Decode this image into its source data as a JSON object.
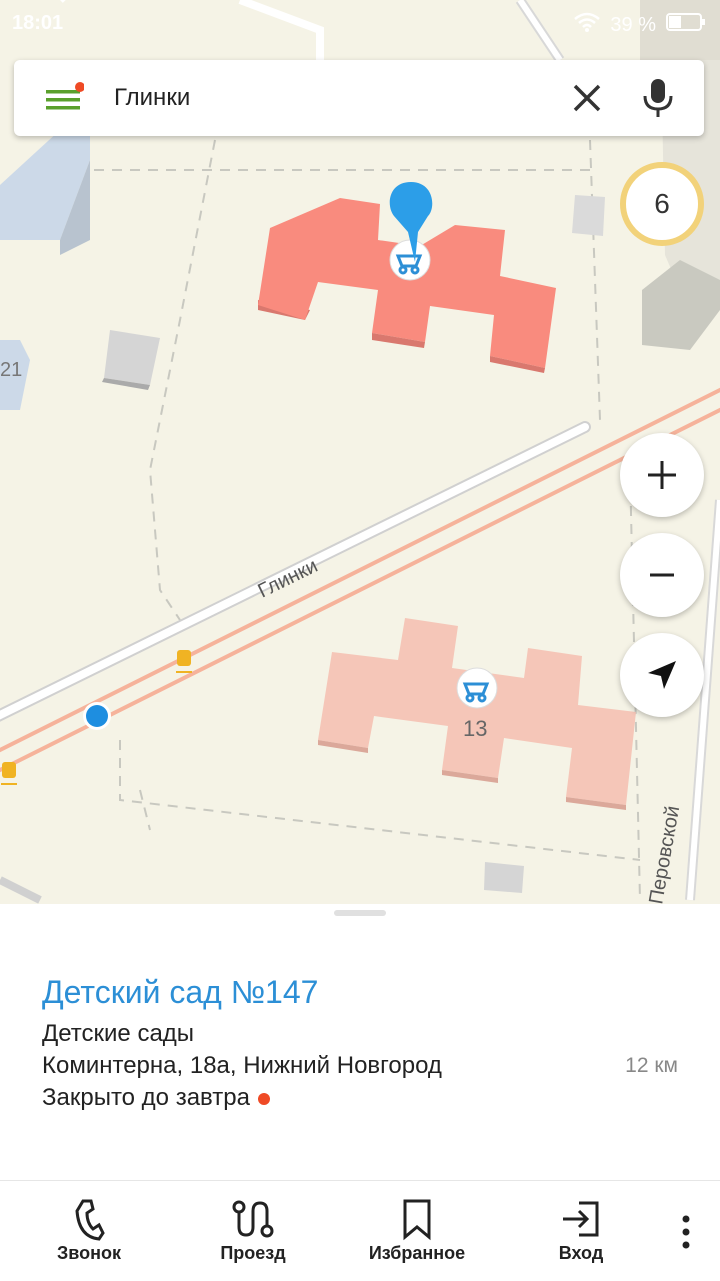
{
  "status_bar": {
    "time": "18:01",
    "battery": "39 %"
  },
  "search": {
    "query": "Глинки"
  },
  "map": {
    "cluster_count": "6",
    "street_glinki": "Глинки",
    "street_perovskoy": "Перовской",
    "house_13": "13",
    "house_21": "21"
  },
  "card": {
    "title": "Детский сад №147",
    "category": "Детские сады",
    "address": "Коминтерна, 18а, Нижний Новгород",
    "distance": "12 км",
    "hours": "Закрыто до завтра"
  },
  "bottom_tabs": [
    {
      "label": "Звонок",
      "icon": "phone-icon"
    },
    {
      "label": "Проезд",
      "icon": "route-icon"
    },
    {
      "label": "Избранное",
      "icon": "bookmark-icon"
    },
    {
      "label": "Вход",
      "icon": "login-icon"
    }
  ],
  "colors": {
    "accent": "#2c8fd6",
    "building_selected": "#f98b7e",
    "building": "#f5c6b8",
    "closed_dot": "#ef4a25"
  }
}
